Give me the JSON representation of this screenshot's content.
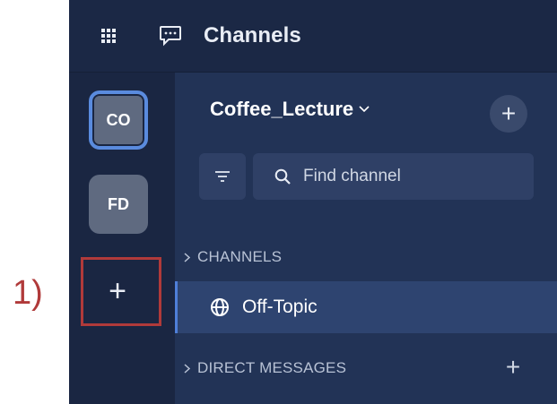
{
  "topbar": {
    "title": "Channels",
    "apps_icon": "grid-icon",
    "channels_icon": "chat-bubble-icon"
  },
  "rail": {
    "teams": [
      {
        "initials": "CO",
        "active": true
      },
      {
        "initials": "FD",
        "active": false
      }
    ],
    "add_team_label": "+"
  },
  "sidebar": {
    "team_name": "Coffee_Lecture",
    "add_label": "+",
    "search": {
      "placeholder": "Find channel",
      "value": ""
    },
    "sections": {
      "channels": {
        "label": "CHANNELS"
      },
      "direct_messages": {
        "label": "DIRECT MESSAGES",
        "add_label": "+"
      }
    },
    "channels": [
      {
        "name": "Off-Topic",
        "icon": "globe-icon",
        "selected": true
      }
    ]
  },
  "annotation": {
    "label": "1)",
    "color": "#b03a3a"
  },
  "colors": {
    "accent": "#5a8bde",
    "topbar_bg": "#1b2845",
    "sidebar_bg": "#223356",
    "selected_row": "#2e4470"
  }
}
